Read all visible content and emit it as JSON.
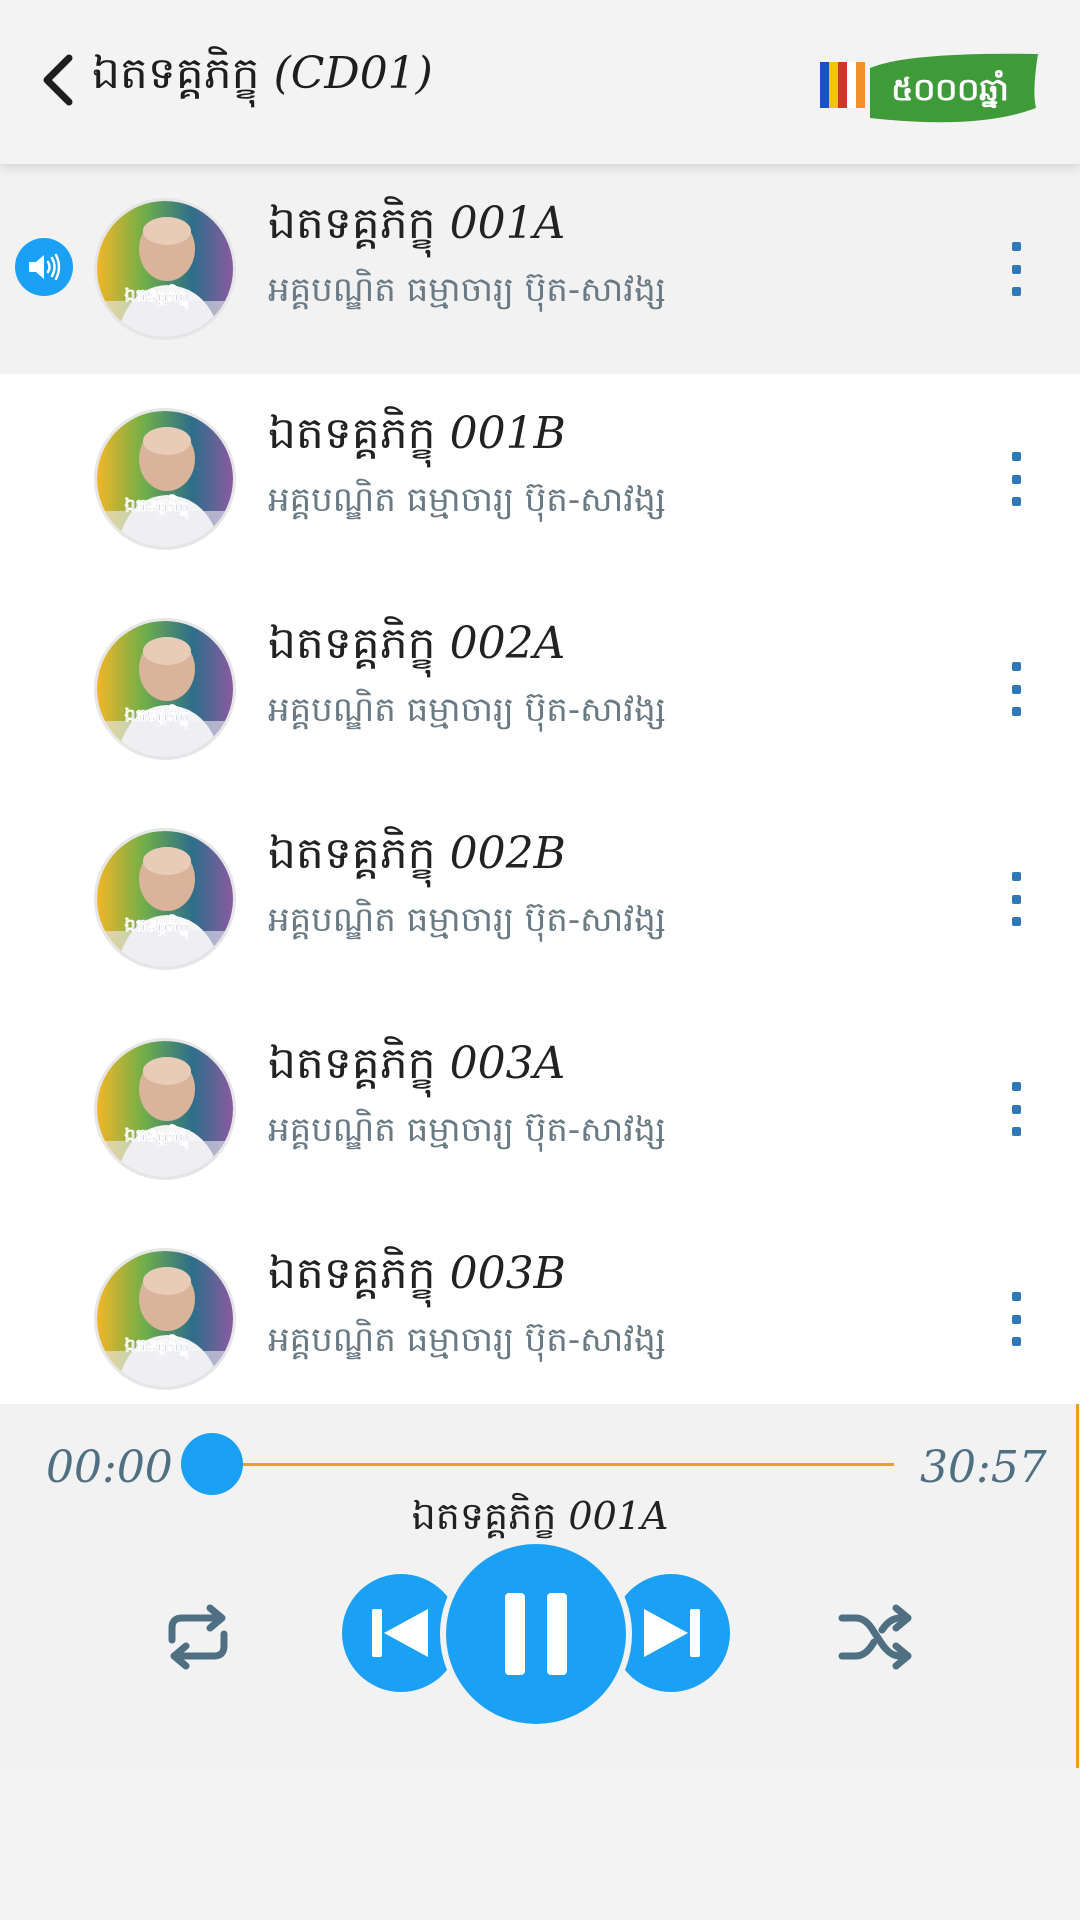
{
  "header": {
    "title": "ឯតទគ្គភិក្ខុ",
    "title_suffix": "(CD01)",
    "logo_text": "៥០០០ឆ្នាំ"
  },
  "tracks": [
    {
      "title": "ឯតទគ្គភិក្ខុ",
      "code": "001A",
      "artist": "អគ្គបណ្ឌិត ធម្មាចារ្យ ប៊ុត-សាវង្ស",
      "playing": true
    },
    {
      "title": "ឯតទគ្គភិក្ខុ",
      "code": "001B",
      "artist": "អគ្គបណ្ឌិត ធម្មាចារ្យ ប៊ុត-សាវង្ស",
      "playing": false
    },
    {
      "title": "ឯតទគ្គភិក្ខុ",
      "code": "002A",
      "artist": "អគ្គបណ្ឌិត ធម្មាចារ្យ ប៊ុត-សាវង្ស",
      "playing": false
    },
    {
      "title": "ឯតទគ្គភិក្ខុ",
      "code": "002B",
      "artist": "អគ្គបណ្ឌិត ធម្មាចារ្យ ប៊ុត-សាវង្ស",
      "playing": false
    },
    {
      "title": "ឯតទគ្គភិក្ខុ",
      "code": "003A",
      "artist": "អគ្គបណ្ឌិត ធម្មាចារ្យ ប៊ុត-សាវង្ស",
      "playing": false
    },
    {
      "title": "ឯតទគ្គភិក្ខុ",
      "code": "003B",
      "artist": "អគ្គបណ្ឌិត ធម្មាចារ្យ ប៊ុត-សាវង្ស",
      "playing": false
    }
  ],
  "avatar_label": "ឯតទគ្គភិក្ខុ",
  "player": {
    "current_time": "00:00",
    "duration": "30:57",
    "progress": 0.0,
    "now_playing_title": "ឯតទគ្គភិក្ខុ",
    "now_playing_code": "001A"
  },
  "icons": {
    "back": "back-arrow-icon",
    "speaker": "speaker-icon",
    "menu": "more-vert-icon",
    "repeat": "repeat-icon",
    "prev": "skip-previous-icon",
    "pause": "pause-icon",
    "next": "skip-next-icon",
    "shuffle": "shuffle-icon"
  },
  "colors": {
    "accent": "#1aa0f4",
    "progress": "#e6a21a",
    "menu_dots": "#2f79b8",
    "artist_text": "#6a7a85",
    "logo_green": "#3f9b3a"
  }
}
